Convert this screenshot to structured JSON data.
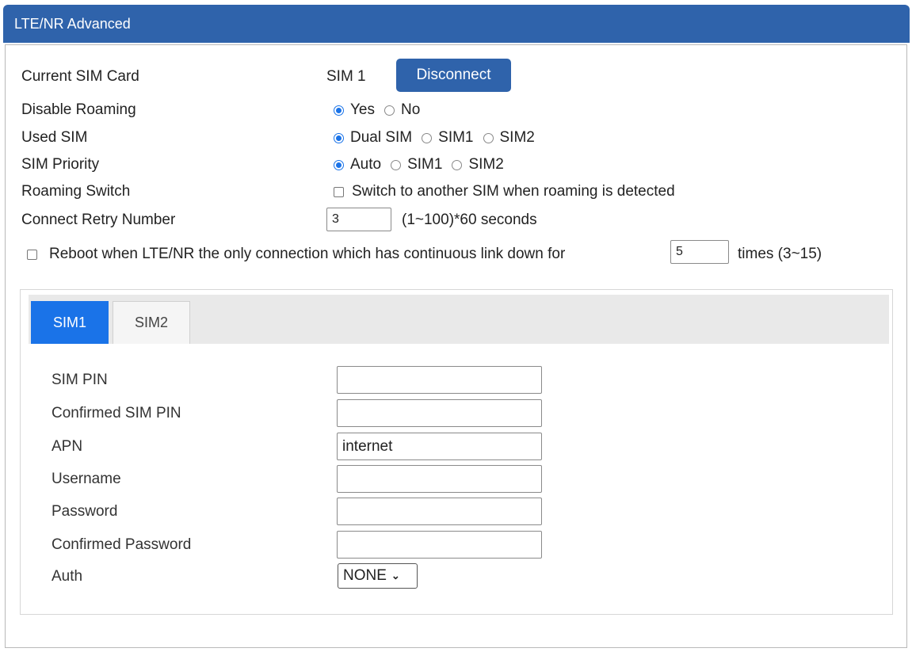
{
  "panel": {
    "title": "LTE/NR Advanced"
  },
  "current_sim": {
    "label": "Current SIM Card",
    "value": "SIM 1",
    "button": "Disconnect"
  },
  "disable_roaming": {
    "label": "Disable Roaming",
    "options": [
      "Yes",
      "No"
    ],
    "selected": "Yes"
  },
  "used_sim": {
    "label": "Used SIM",
    "options": [
      "Dual SIM",
      "SIM1",
      "SIM2"
    ],
    "selected": "Dual SIM"
  },
  "sim_priority": {
    "label": "SIM Priority",
    "options": [
      "Auto",
      "SIM1",
      "SIM2"
    ],
    "selected": "Auto"
  },
  "roaming_switch": {
    "label": "Roaming Switch",
    "checkbox_label": "Switch to another SIM when roaming is detected",
    "checked": false
  },
  "connect_retry": {
    "label": "Connect Retry Number",
    "value": "3",
    "hint": "(1~100)*60 seconds"
  },
  "reboot": {
    "label": "Reboot when LTE/NR the only connection which has continuous link down for",
    "value": "5",
    "hint": "times (3~15)",
    "checked": false
  },
  "tabs": [
    {
      "label": "SIM1",
      "active": true
    },
    {
      "label": "SIM2",
      "active": false
    }
  ],
  "sim_form": {
    "sim_pin": {
      "label": "SIM PIN",
      "value": ""
    },
    "confirmed_sim_pin": {
      "label": "Confirmed SIM PIN",
      "value": ""
    },
    "apn": {
      "label": "APN",
      "value": "internet"
    },
    "username": {
      "label": "Username",
      "value": ""
    },
    "password": {
      "label": "Password",
      "value": ""
    },
    "confirmed_password": {
      "label": "Confirmed Password",
      "value": ""
    },
    "auth": {
      "label": "Auth",
      "value": "NONE"
    }
  },
  "colors": {
    "header": "#2f63ab",
    "accent": "#1a73e8"
  }
}
